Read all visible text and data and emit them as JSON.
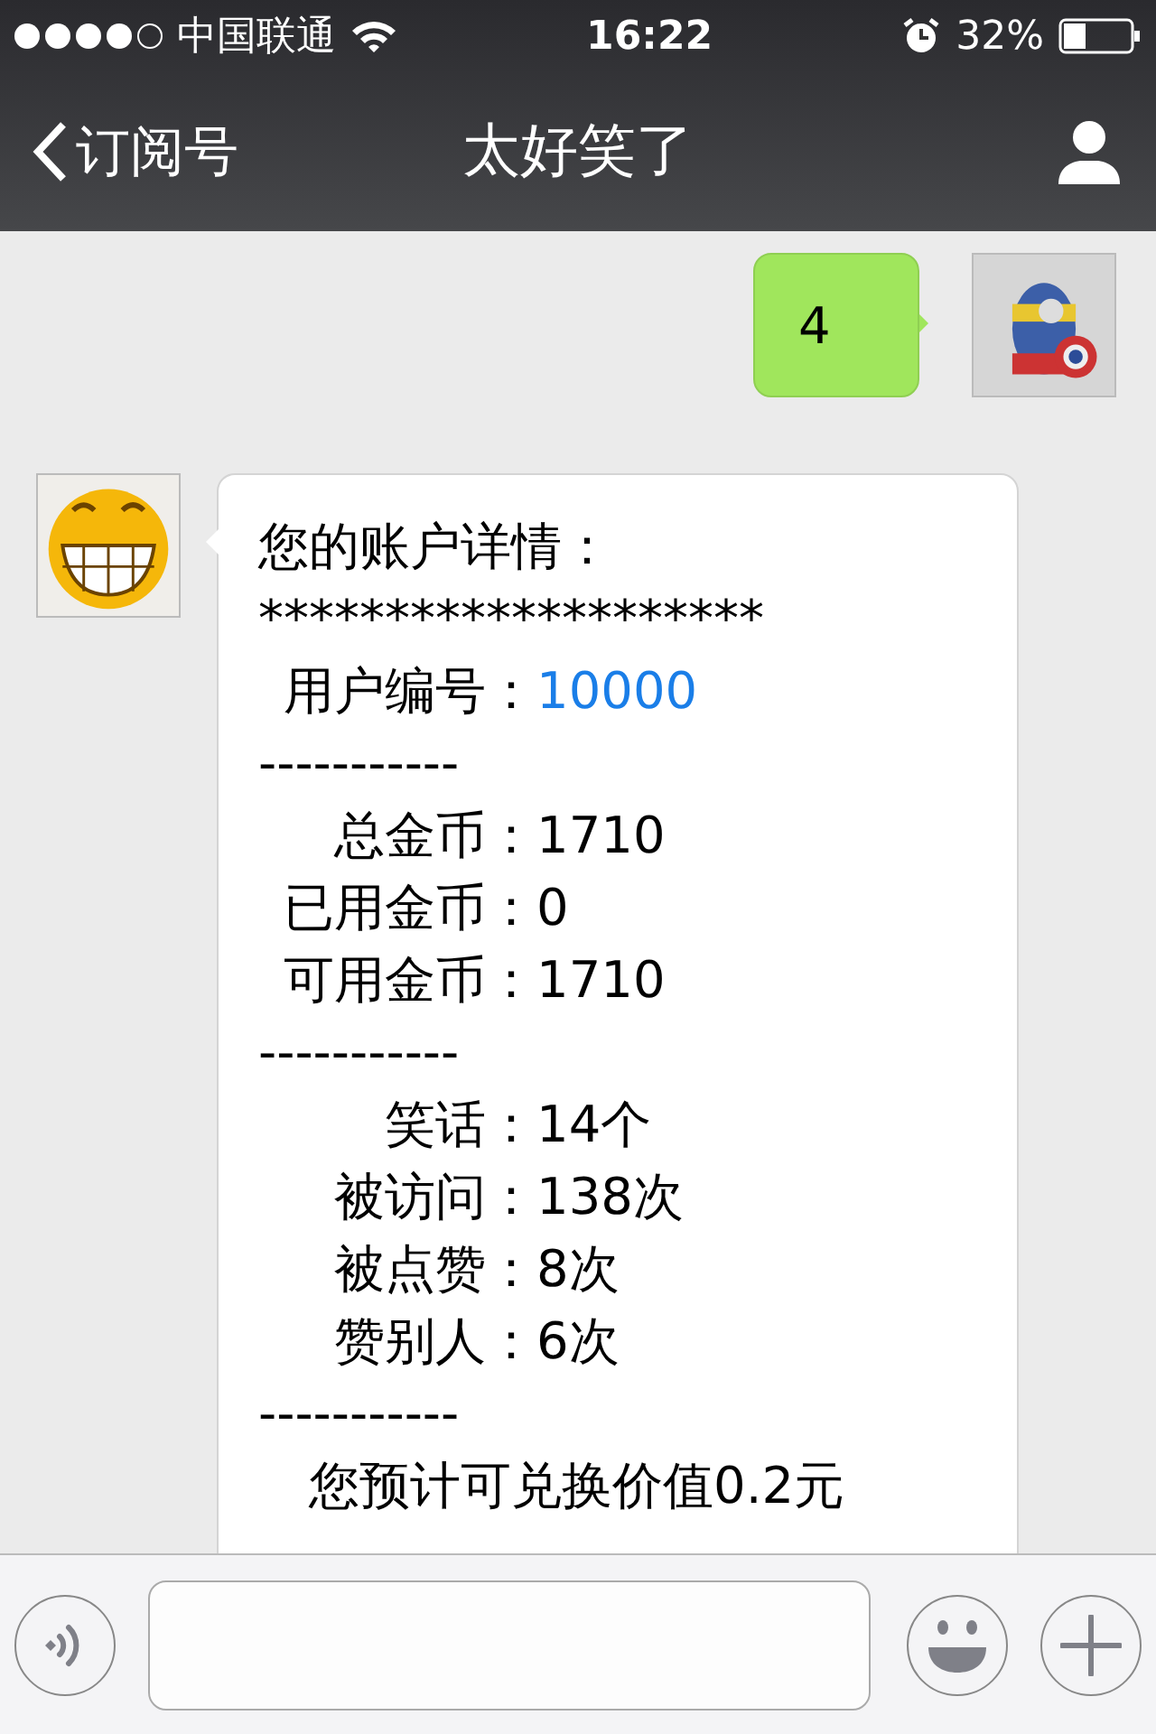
{
  "status_bar": {
    "carrier": "中国联通",
    "time": "16:22",
    "battery_percent": "32%"
  },
  "nav": {
    "back": "订阅号",
    "title": "太好笑了"
  },
  "messages": [
    {
      "kind": "sent",
      "text": "4"
    },
    {
      "kind": "received",
      "lines": [
        {
          "kind": "text",
          "text": "您的账户详情："
        },
        {
          "kind": "rule",
          "text": "********************"
        },
        {
          "kind": "field",
          "label": "用户编号：",
          "value": "10000",
          "link": true
        },
        {
          "kind": "rule",
          "text": "-----------"
        },
        {
          "kind": "field",
          "label": "总金币：",
          "value": "1710",
          "link": false
        },
        {
          "kind": "field",
          "label": "已用金币：",
          "value": "0",
          "link": false
        },
        {
          "kind": "field",
          "label": "可用金币：",
          "value": "1710",
          "link": false
        },
        {
          "kind": "rule",
          "text": "-----------"
        },
        {
          "kind": "field",
          "label": "笑话：",
          "value": "14个",
          "link": false
        },
        {
          "kind": "field",
          "label": "被访问：",
          "value": "138次",
          "link": false
        },
        {
          "kind": "field",
          "label": "被点赞：",
          "value": "8次",
          "link": false
        },
        {
          "kind": "field",
          "label": "赞别人：",
          "value": "6次",
          "link": false
        },
        {
          "kind": "rule",
          "text": "-----------"
        },
        {
          "kind": "note",
          "text": "您预计可兑换价值0.2元"
        }
      ]
    }
  ]
}
